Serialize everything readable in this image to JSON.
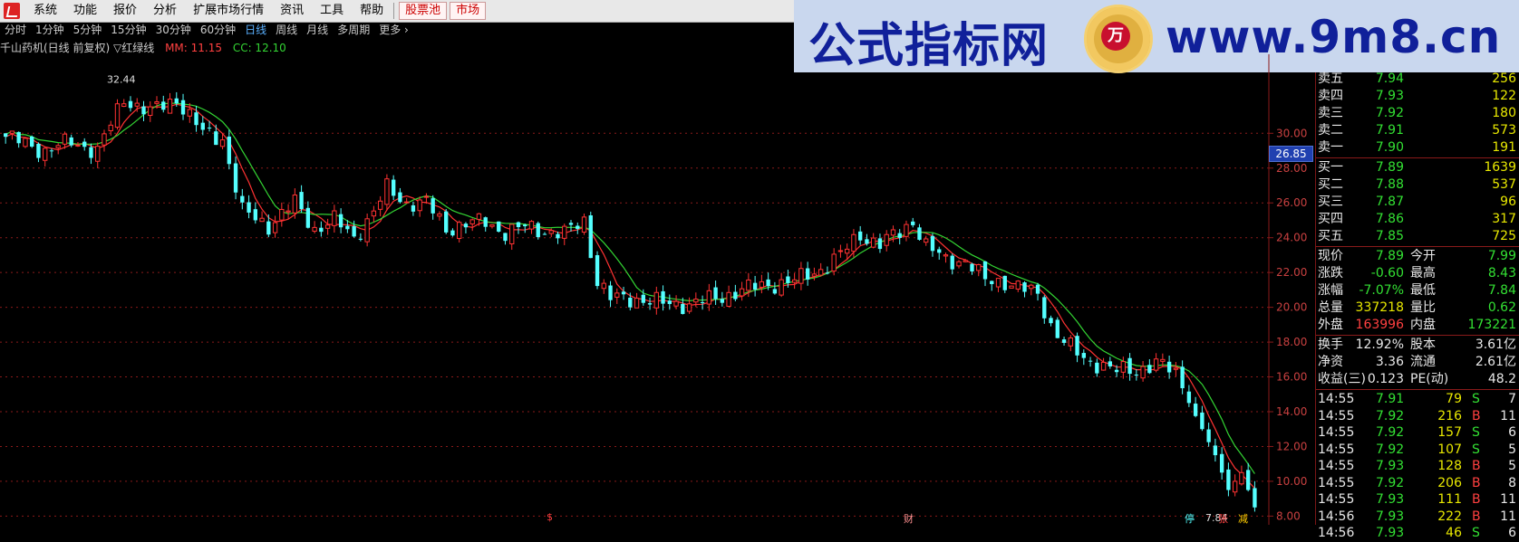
{
  "menubar": {
    "items": [
      "系统",
      "功能",
      "报价",
      "分析",
      "扩展市场行情",
      "资讯",
      "工具",
      "帮助"
    ],
    "special": [
      "股票池",
      "市场"
    ]
  },
  "banner": {
    "title": "公式指标网",
    "medal_text": "万",
    "site": "www.9m8.cn"
  },
  "periods": [
    "分时",
    "1分钟",
    "5分钟",
    "15分钟",
    "30分钟",
    "60分钟",
    "日线",
    "周线",
    "月线",
    "多周期",
    "更多"
  ],
  "active_period": "日线",
  "info": {
    "title": "千山药机(日线 前复权) ▽红绿线",
    "mm_label": "MM: 11.15",
    "cc_label": "CC: 12.10"
  },
  "colors": {
    "up": "#ff3232",
    "down": "#54ffff",
    "ma1": "#ff3232",
    "ma2": "#33d433",
    "axis": "#8a1a1a"
  },
  "chart_data": {
    "type": "candlestick",
    "ylim": [
      7.5,
      33.5
    ],
    "yticks": [
      "30.00",
      "28.00",
      "26.00",
      "24.00",
      "22.00",
      "20.00",
      "18.00",
      "16.00",
      "14.00",
      "12.00",
      "10.00",
      "8.00"
    ],
    "current_price_tag": "26.85",
    "high_label": "32.44",
    "low_label": "7.84",
    "bottom_markers": [
      {
        "text": "$",
        "color": "#ff4040",
        "pos": 0.36
      },
      {
        "text": "财",
        "color": "#ff9090",
        "pos": 0.595
      },
      {
        "text": "停",
        "color": "#54ffff",
        "pos": 0.78
      },
      {
        "text": "张",
        "color": "#ff4040",
        "pos": 0.802
      },
      {
        "text": "减",
        "color": "#ffcc00",
        "pos": 0.815
      }
    ],
    "keypoints": [
      [
        0,
        29.8
      ],
      [
        6,
        29.0
      ],
      [
        10,
        29.5
      ],
      [
        14,
        29.0
      ],
      [
        18,
        32.0
      ],
      [
        22,
        31.2
      ],
      [
        26,
        32.0
      ],
      [
        30,
        30.0
      ],
      [
        33,
        29.7
      ],
      [
        36,
        25.5
      ],
      [
        40,
        24.7
      ],
      [
        44,
        26.0
      ],
      [
        47,
        24.5
      ],
      [
        50,
        25.0
      ],
      [
        53,
        24.0
      ],
      [
        56,
        25.5
      ],
      [
        58,
        26.8
      ],
      [
        61,
        26.0
      ],
      [
        64,
        26.0
      ],
      [
        67,
        24.5
      ],
      [
        70,
        24.8
      ],
      [
        73,
        24.9
      ],
      [
        76,
        24.3
      ],
      [
        79,
        24.6
      ],
      [
        82,
        24.4
      ],
      [
        85,
        24.2
      ],
      [
        88,
        25.0
      ],
      [
        90,
        21.5
      ],
      [
        92,
        20.5
      ],
      [
        96,
        20.5
      ],
      [
        100,
        20.2
      ],
      [
        104,
        20.2
      ],
      [
        108,
        20.5
      ],
      [
        112,
        21.0
      ],
      [
        116,
        21.3
      ],
      [
        120,
        21.5
      ],
      [
        124,
        22.2
      ],
      [
        127,
        23.0
      ],
      [
        130,
        24.2
      ],
      [
        133,
        23.6
      ],
      [
        136,
        24.3
      ],
      [
        138,
        25.0
      ],
      [
        140,
        23.5
      ],
      [
        143,
        22.7
      ],
      [
        146,
        22.7
      ],
      [
        149,
        21.5
      ],
      [
        152,
        21.5
      ],
      [
        155,
        21.0
      ],
      [
        157,
        20.7
      ],
      [
        159,
        19.0
      ],
      [
        161,
        18.0
      ],
      [
        164,
        17.0
      ],
      [
        167,
        16.7
      ],
      [
        169,
        16.3
      ],
      [
        172,
        16.4
      ],
      [
        175,
        16.8
      ],
      [
        178,
        16.2
      ],
      [
        180,
        14.5
      ],
      [
        182,
        13.0
      ],
      [
        184,
        11.5
      ],
      [
        185,
        10.5
      ],
      [
        186,
        9.5
      ],
      [
        188,
        10.5
      ],
      [
        190,
        8.5
      ]
    ]
  },
  "panel": {
    "asks": [
      {
        "label": "卖五",
        "price": "7.94",
        "vol": "256"
      },
      {
        "label": "卖四",
        "price": "7.93",
        "vol": "122"
      },
      {
        "label": "卖三",
        "price": "7.92",
        "vol": "180"
      },
      {
        "label": "卖二",
        "price": "7.91",
        "vol": "573"
      },
      {
        "label": "卖一",
        "price": "7.90",
        "vol": "191"
      }
    ],
    "bids": [
      {
        "label": "买一",
        "price": "7.89",
        "vol": "1639"
      },
      {
        "label": "买二",
        "price": "7.88",
        "vol": "537"
      },
      {
        "label": "买三",
        "price": "7.87",
        "vol": "96"
      },
      {
        "label": "买四",
        "price": "7.86",
        "vol": "317"
      },
      {
        "label": "买五",
        "price": "7.85",
        "vol": "725"
      }
    ],
    "stats": [
      {
        "l1": "现价",
        "v1": "7.89",
        "c1": "green",
        "l2": "今开",
        "v2": "7.99",
        "c2": "green"
      },
      {
        "l1": "涨跌",
        "v1": "-0.60",
        "c1": "green",
        "l2": "最高",
        "v2": "8.43",
        "c2": "green"
      },
      {
        "l1": "涨幅",
        "v1": "-7.07%",
        "c1": "green",
        "l2": "最低",
        "v2": "7.84",
        "c2": "green"
      },
      {
        "l1": "总量",
        "v1": "337218",
        "c1": "yellow",
        "l2": "量比",
        "v2": "0.62",
        "c2": "green"
      },
      {
        "l1": "外盘",
        "v1": "163996",
        "c1": "red",
        "l2": "内盘",
        "v2": "173221",
        "c2": "green"
      }
    ],
    "stats2": [
      {
        "l1": "换手",
        "v1": "12.92%",
        "l2": "股本",
        "v2": "3.61亿"
      },
      {
        "l1": "净资",
        "v1": "3.36",
        "l2": "流通",
        "v2": "2.61亿"
      },
      {
        "l1": "收益(三)",
        "v1": "0.123",
        "l2": "PE(动)",
        "v2": "48.2"
      }
    ],
    "ticks": [
      {
        "time": "14:55",
        "price": "7.91",
        "vol": "79",
        "bs": "S",
        "n": "7"
      },
      {
        "time": "14:55",
        "price": "7.92",
        "vol": "216",
        "bs": "B",
        "n": "11"
      },
      {
        "time": "14:55",
        "price": "7.92",
        "vol": "157",
        "bs": "S",
        "n": "6"
      },
      {
        "time": "14:55",
        "price": "7.92",
        "vol": "107",
        "bs": "S",
        "n": "5"
      },
      {
        "time": "14:55",
        "price": "7.93",
        "vol": "128",
        "bs": "B",
        "n": "5"
      },
      {
        "time": "14:55",
        "price": "7.92",
        "vol": "206",
        "bs": "B",
        "n": "8"
      },
      {
        "time": "14:55",
        "price": "7.93",
        "vol": "111",
        "bs": "B",
        "n": "11"
      },
      {
        "time": "14:56",
        "price": "7.93",
        "vol": "222",
        "bs": "B",
        "n": "11"
      },
      {
        "time": "14:56",
        "price": "7.93",
        "vol": "46",
        "bs": "S",
        "n": "6"
      }
    ]
  }
}
